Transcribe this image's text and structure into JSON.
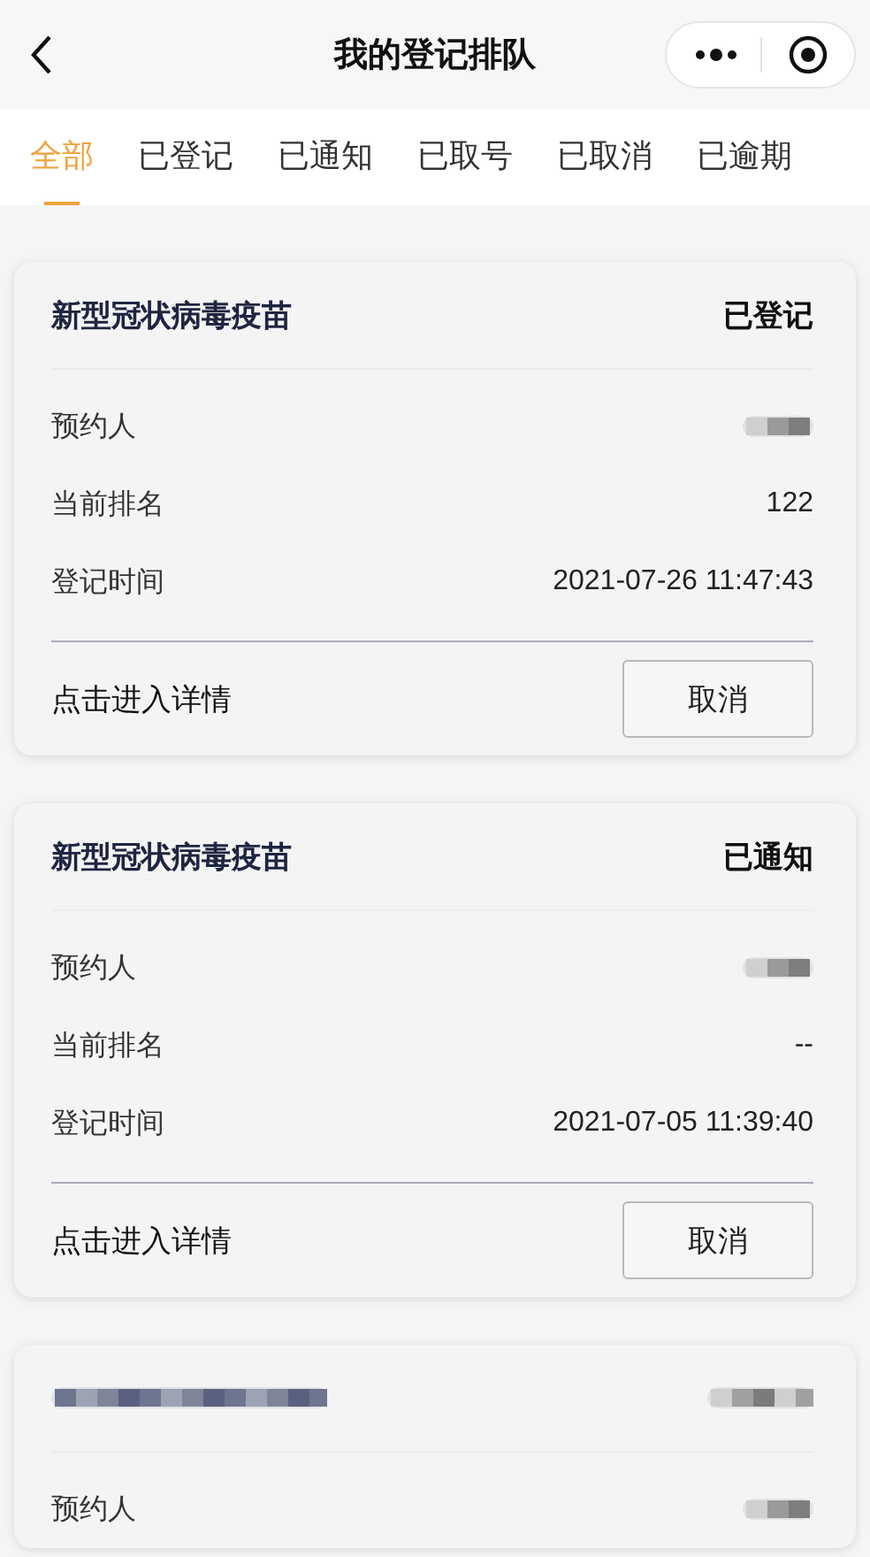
{
  "nav": {
    "title": "我的登记排队"
  },
  "tabs": [
    {
      "label": "全部",
      "selected": true
    },
    {
      "label": "已登记",
      "selected": false
    },
    {
      "label": "已通知",
      "selected": false
    },
    {
      "label": "已取号",
      "selected": false
    },
    {
      "label": "已取消",
      "selected": false
    },
    {
      "label": "已逾期",
      "selected": false
    }
  ],
  "cards": [
    {
      "title": "新型冠状病毒疫苗",
      "status": "已登记",
      "fields": [
        {
          "label": "预约人",
          "redacted": true
        },
        {
          "label": "当前排名",
          "value": "122"
        },
        {
          "label": "登记时间",
          "value": "2021-07-26 11:47:43"
        }
      ],
      "detail_link": "点击进入详情",
      "button": "取消"
    },
    {
      "title": "新型冠状病毒疫苗",
      "status": "已通知",
      "fields": [
        {
          "label": "预约人",
          "redacted": true
        },
        {
          "label": "当前排名",
          "value": "--"
        },
        {
          "label": "登记时间",
          "value": "2021-07-05 11:39:40"
        }
      ],
      "detail_link": "点击进入详情",
      "button": "取消"
    },
    {
      "title_redacted": true,
      "status_redacted": true,
      "fields": [
        {
          "label": "预约人",
          "redacted": true
        }
      ]
    }
  ]
}
